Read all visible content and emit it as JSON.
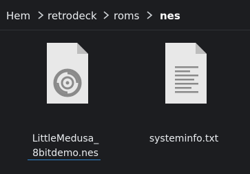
{
  "breadcrumb": {
    "items": [
      "Hem",
      "retrodeck",
      "roms",
      "nes"
    ],
    "separator_icon": "chevron-right-icon"
  },
  "files": [
    {
      "name_line1": "LittleMedusa_",
      "name_line2": "8bitdemo.nes",
      "icon": "disc-file-icon",
      "selected": true
    },
    {
      "name_line1": "systeminfo.txt",
      "name_line2": "",
      "icon": "text-file-icon",
      "selected": false
    }
  ],
  "colors": {
    "background": "#1c1d20",
    "text": "#e9ecef",
    "selection_underline": "#2f87cf",
    "file_paper": "#e8e8e8",
    "file_fold": "#bdbdbd"
  }
}
